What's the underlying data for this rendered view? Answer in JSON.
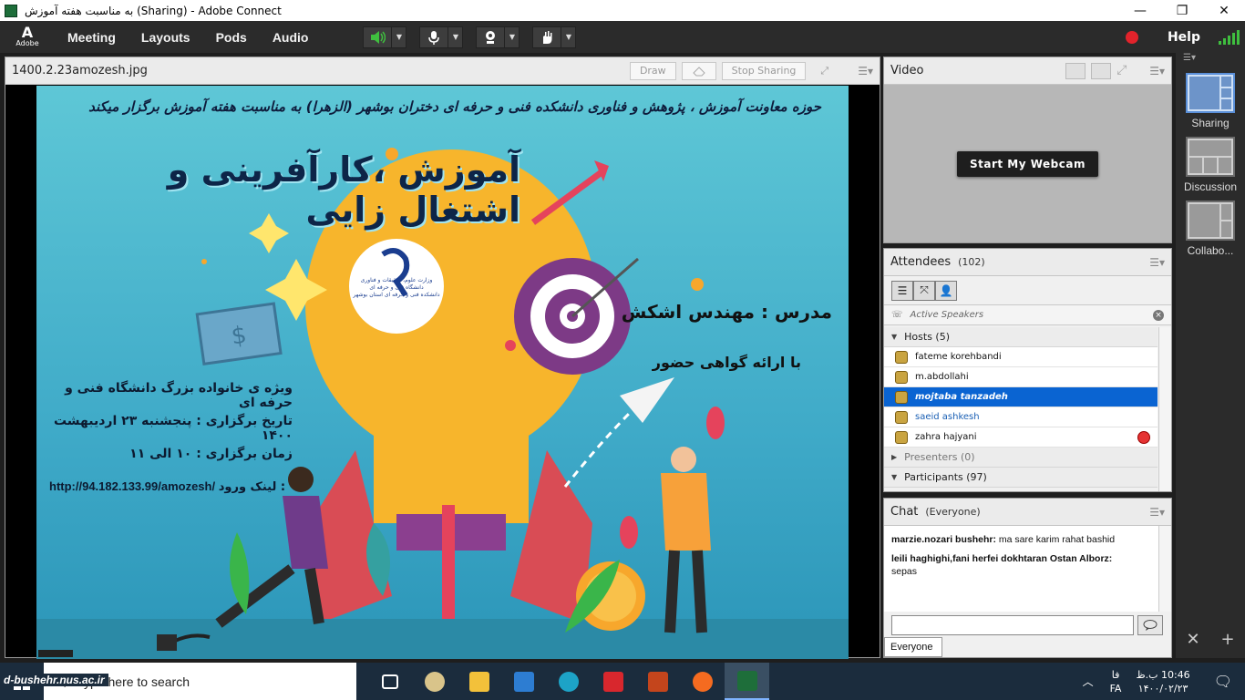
{
  "window": {
    "title": "به مناسبت هفته آموزش (Sharing) - Adobe Connect",
    "minimize": "—",
    "maximize": "❐",
    "close": "✕"
  },
  "menubar": {
    "logo_text": "Adobe",
    "items": [
      "Meeting",
      "Layouts",
      "Pods",
      "Audio"
    ],
    "help": "Help",
    "speaker_icon": "speaker-icon",
    "mic_icon": "microphone-icon",
    "camera_icon": "webcam-icon",
    "raise_hand_icon": "raise-hand-icon",
    "accent": "#3fbf3f",
    "record_color": "#e2232b"
  },
  "share_pod": {
    "title": "1400.2.23amozesh.jpg",
    "draw": "Draw",
    "stop_sharing": "Stop Sharing"
  },
  "slide": {
    "top_line": "حوزه معاونت آموزش ، پژوهش و فناوری دانشکده فنی و حرفه ای دختران بوشهر (الزهرا) به مناسبت هفته آموزش برگزار میکند",
    "title": "آموزش ،کارآفرینی و اشتغال زایی",
    "teacher": "مدرس : مهندس اشکش",
    "certificate": "با ارائه گواهی حضور",
    "audience": "ویژه ی خانواده بزرگ دانشگاه فنی و حرفه ای",
    "date": "تاریخ برگزاری : پنجشنبه ۲۳ اردیبهشت ۱۴۰۰",
    "time": "زمان برگزاری : ۱۰ الی ۱۱",
    "link_label": "لینک ورود :",
    "link_url": "http://94.182.133.99/amozesh/",
    "logo_lines": [
      "وزارت علوم، تحقیقات و فناوری",
      "دانشگاه فنی و حرفه ای",
      "دانشکده فنی و حرفه ای استان بوشهر"
    ]
  },
  "video_pod": {
    "title": "Video",
    "start_webcam": "Start My Webcam"
  },
  "attendees_pod": {
    "title": "Attendees",
    "count": "(102)",
    "active_speakers": "Active Speakers",
    "hosts_label": "Hosts (5)",
    "hosts": [
      {
        "name": "fateme korehbandi"
      },
      {
        "name": "m.abdollahi"
      },
      {
        "name": "mojtaba tanzadeh"
      },
      {
        "name": "saeid ashkesh"
      },
      {
        "name": "zahra hajyani"
      }
    ],
    "presenters_label": "Presenters (0)",
    "participants_label": "Participants (97)",
    "selected_color": "#0a64d2"
  },
  "chat_pod": {
    "title": "Chat",
    "scope": "(Everyone)",
    "messages": [
      {
        "sender": "marzie.nozari bushehr:",
        "text": "ma sare karim rahat bashid"
      },
      {
        "sender": "leili haghighi,fani herfei dokhtaran Ostan Alborz:",
        "text": "sepas"
      }
    ],
    "tab": "Everyone"
  },
  "layouts_bar": {
    "items": [
      "Sharing",
      "Discussion",
      "Collabo..."
    ],
    "add": "+",
    "tools": "✕"
  },
  "taskbar": {
    "search_placeholder": "Type here to search",
    "watermark": "d-bushehr.nus.ac.ir",
    "lang_top": "فا",
    "lang_bottom": "FA",
    "time": "10:46 ب.ظ",
    "date": "۱۴۰۰/۰۲/۲۳"
  }
}
